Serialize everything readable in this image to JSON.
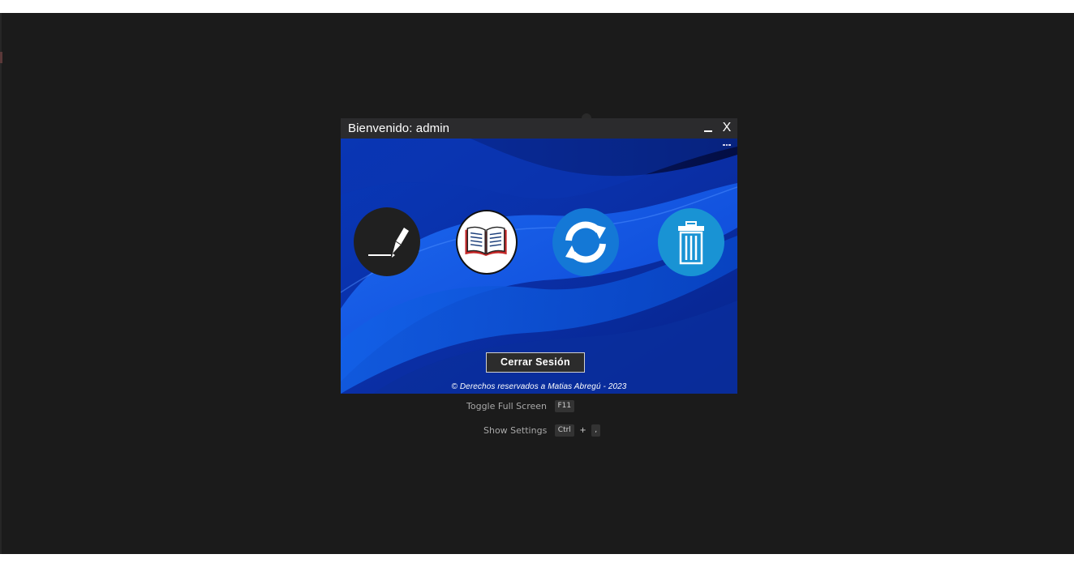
{
  "window": {
    "title": "Bienvenido: admin",
    "minimize_label": "_",
    "close_label": "X"
  },
  "actions": [
    {
      "name": "edit",
      "icon": "pencil-icon",
      "color": "#202020"
    },
    {
      "name": "read",
      "icon": "book-icon",
      "color": "#ffffff"
    },
    {
      "name": "refresh",
      "icon": "refresh-icon",
      "color": "#1478d6"
    },
    {
      "name": "delete",
      "icon": "trash-icon",
      "color": "#1993d4"
    }
  ],
  "logout_label": "Cerrar Sesión",
  "copyright": "© Derechos reservados a Matias Abregú - 2023",
  "shortcuts": {
    "fullscreen": {
      "label": "Toggle Full Screen",
      "key": "F11"
    },
    "settings": {
      "label": "Show Settings",
      "key1": "Ctrl",
      "plus": "+",
      "key2": ","
    }
  },
  "colors": {
    "workspace_bg": "#1b1b1b",
    "titlebar_bg": "#2b2b2d",
    "accent_blue": "#0a3fd0"
  }
}
